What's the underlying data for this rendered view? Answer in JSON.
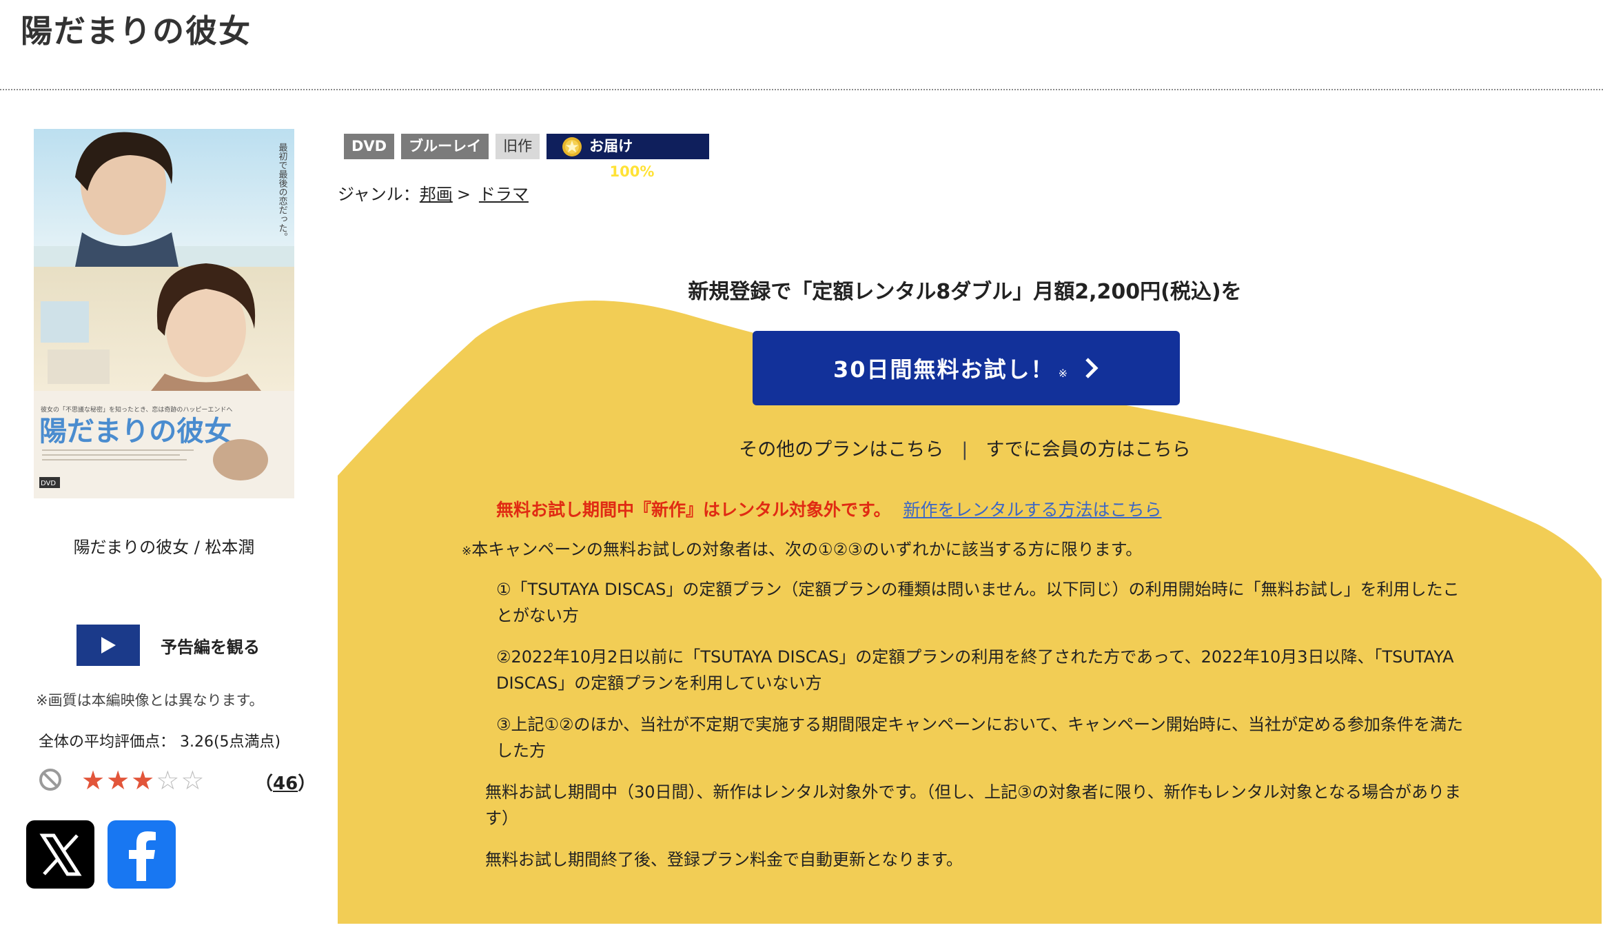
{
  "header": {
    "title": "陽だまりの彼女"
  },
  "jacket": {
    "poster_title": "陽だまりの彼女",
    "tagline_vertical": "最初で最後の恋だった。",
    "caption": "陽だまりの彼女 / 松本潤"
  },
  "trailer": {
    "label": "予告編を観る"
  },
  "notes": {
    "quality": "※画質は本編映像とは異なります。"
  },
  "rating": {
    "label": "全体の平均評価点： 3.26(5点満点)",
    "value": 3.26,
    "max": 5,
    "count_open": "（",
    "count": "46",
    "count_close": "）"
  },
  "badges": {
    "dvd": "DVD",
    "bluray": "ブルーレイ",
    "old": "旧作",
    "delivery_label": "お届け率:",
    "delivery_value": "100%"
  },
  "genre": {
    "label": "ジャンル：",
    "path": [
      "邦画",
      "ドラマ"
    ],
    "separator": ">"
  },
  "campaign": {
    "headline": "新規登録で「定額レンタル8ダブル」月額2,200円(税込)を",
    "cta_label": "30日間無料お試し！",
    "cta_mark": "※",
    "other_plans": "その他のプランはこちら",
    "pipe": "|",
    "members": "すでに会員の方はこちら",
    "warning": "無料お試し期間中『新作』はレンタル対象外です。",
    "warning_link": "新作をレンタルする方法はこちら",
    "terms_mark": "※",
    "terms_intro": "本キャンペーンの無料お試しの対象者は、次の①②③のいずれかに該当する方に限ります。",
    "term1": "①「TSUTAYA DISCAS」の定額プラン（定額プランの種類は問いません。以下同じ）の利用開始時に「無料お試し」を利用したことがない方",
    "term2": "②2022年10月2日以前に「TSUTAYA DISCAS」の定額プランの利用を終了された方であって、2022年10月3日以降、「TSUTAYA DISCAS」の定額プランを利用していない方",
    "term3": "③上記①②のほか、当社が不定期で実施する期間限定キャンペーンにおいて、キャンペーン開始時に、当社が定める参加条件を満たした方",
    "note1": "無料お試し期間中（30日間）、新作はレンタル対象外です。（但し、上記③の対象者に限り、新作もレンタル対象となる場合があります）",
    "note2": "無料お試し期間終了後、登録プラン料金で自動更新となります。"
  },
  "colors": {
    "campaign_bg": "#f2cd55",
    "cta_bg": "#12319a",
    "warning_red": "#e02b13",
    "link_blue": "#3c67c5",
    "star_red": "#e2553a"
  }
}
